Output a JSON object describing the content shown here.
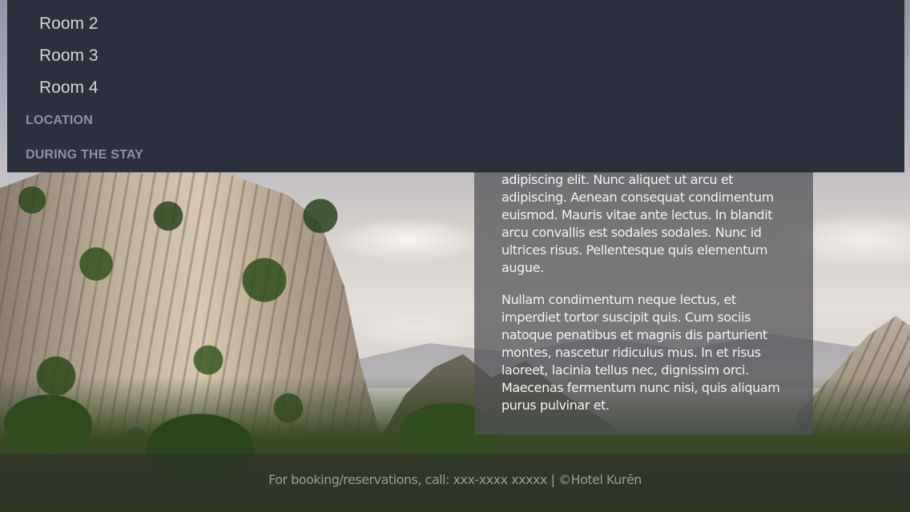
{
  "navigation": {
    "sub_items": [
      {
        "label": "Room 2"
      },
      {
        "label": "Room 3"
      },
      {
        "label": "Room 4"
      }
    ],
    "items": [
      {
        "label": "LOCATION"
      },
      {
        "label": "DURING THE STAY"
      }
    ]
  },
  "content": {
    "paragraphs": [
      "adipiscing elit. Nunc aliquet ut arcu et adipiscing. Aenean consequat condimentum euismod. Mauris vitae ante lectus. In blandit arcu convallis est sodales sodales. Nunc id ultrices risus. Pellentesque quis elementum augue.",
      "Nullam condimentum neque lectus, et imperdiet tortor suscipit quis. Cum sociis natoque penatibus et magnis dis parturient montes, nascetur ridiculus mus. In et risus laoreet, lacinia tellus nec, dignissim orci. Maecenas fermentum nunc nisi, quis aliquam purus pulvinar et."
    ]
  },
  "footer": {
    "text": "For booking/reservations, call: xxx-xxxx xxxxx | ©Hotel Kurēn"
  }
}
